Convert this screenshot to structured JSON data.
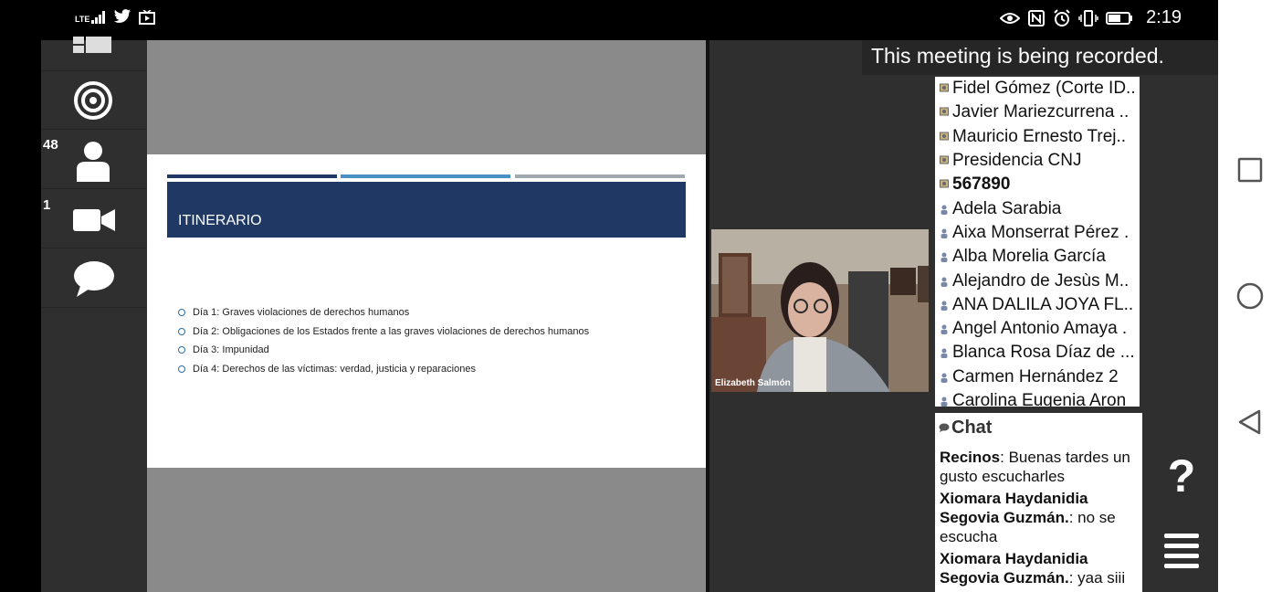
{
  "status_bar": {
    "network": "LTE",
    "time": "2:19"
  },
  "toolbar": {
    "participants_count": "48",
    "video_count": "1"
  },
  "slide": {
    "title": "ITINERARIO",
    "bullets": [
      "Día 1: Graves violaciones de derechos humanos",
      "Día 2: Obligaciones de los Estados frente a las graves violaciones de derechos humanos",
      "Día 3: Impunidad",
      "Día 4: Derechos de las víctimas: verdad, justicia y reparaciones"
    ],
    "colors": {
      "title_bg": "#1f3864",
      "bar1": "#1f3864",
      "bar2": "#4a90c2",
      "bar3": "#a0a8b0"
    }
  },
  "recording_banner": "This meeting is being recorded.",
  "video": {
    "name": "Elizabeth Salmón"
  },
  "participants": [
    {
      "name": "Fidel Gómez (Corte ID..",
      "bold": false
    },
    {
      "name": "Javier Mariezcurrena ..",
      "bold": false
    },
    {
      "name": "Mauricio Ernesto Trej..",
      "bold": false
    },
    {
      "name": "Presidencia CNJ",
      "bold": false
    },
    {
      "name": "567890",
      "bold": true
    },
    {
      "name": "Adela Sarabia",
      "bold": false
    },
    {
      "name": "Aixa Monserrat Pérez .",
      "bold": false
    },
    {
      "name": "Alba Morelia García",
      "bold": false
    },
    {
      "name": "Alejandro de Jesùs M..",
      "bold": false
    },
    {
      "name": "ANA DALILA JOYA FL..",
      "bold": false
    },
    {
      "name": "Angel Antonio Amaya .",
      "bold": false
    },
    {
      "name": "Blanca Rosa Díaz de ...",
      "bold": false
    },
    {
      "name": "Carmen Hernández 2",
      "bold": false
    },
    {
      "name": "Carolina Eugenia Aron",
      "bold": false
    }
  ],
  "chat": {
    "title": "Chat",
    "messages": [
      {
        "author": "Recinos",
        "text": ": Buenas tardes un gusto escucharles"
      },
      {
        "author": "Xiomara Haydanidia Segovia Guzmán.",
        "text": ": no se escucha"
      },
      {
        "author": "Xiomara Haydanidia Segovia Guzmán.",
        "text": ": yaa siii"
      }
    ]
  },
  "help_label": "?"
}
